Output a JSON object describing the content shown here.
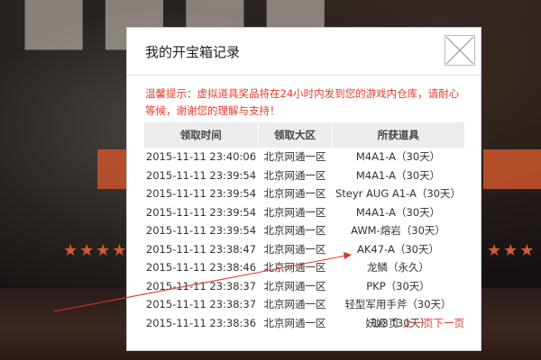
{
  "modal": {
    "title": "我的开宝箱记录",
    "notice": "温馨提示：虚拟道具奖品将在24小时内发到您的游戏内仓库，请耐心等候，谢谢您的理解与支持！",
    "columns": [
      "领取时间",
      "领取大区",
      "所获道具"
    ],
    "rows": [
      [
        "2015-11-11 23:40:06",
        "北京网通一区",
        "M4A1-A（30天）"
      ],
      [
        "2015-11-11 23:39:54",
        "北京网通一区",
        "M4A1-A（30天）"
      ],
      [
        "2015-11-11 23:39:54",
        "北京网通一区",
        "Steyr AUG A1-A（30天）"
      ],
      [
        "2015-11-11 23:39:54",
        "北京网通一区",
        "M4A1-A（30天）"
      ],
      [
        "2015-11-11 23:39:54",
        "北京网通一区",
        "AWM-熔岩（30天）"
      ],
      [
        "2015-11-11 23:38:47",
        "北京网通一区",
        "AK47-A（30天）"
      ],
      [
        "2015-11-11 23:38:46",
        "北京网通一区",
        "龙鳞（永久）"
      ],
      [
        "2015-11-11 23:38:37",
        "北京网通一区",
        "PKP（30天）"
      ],
      [
        "2015-11-11 23:38:37",
        "北京网通一区",
        "轻型军用手斧（30天）"
      ],
      [
        "2015-11-11 23:38:36",
        "北京网通一区",
        "妖姬（30天）"
      ]
    ],
    "pager": {
      "page_info": "1/3页",
      "prev": "上一页",
      "next": "下一页"
    }
  },
  "colors": {
    "accent_red": "#e23b2b",
    "header_gray": "#ececec"
  },
  "icons": {
    "close": "close-icon",
    "stars": "star-icon"
  }
}
